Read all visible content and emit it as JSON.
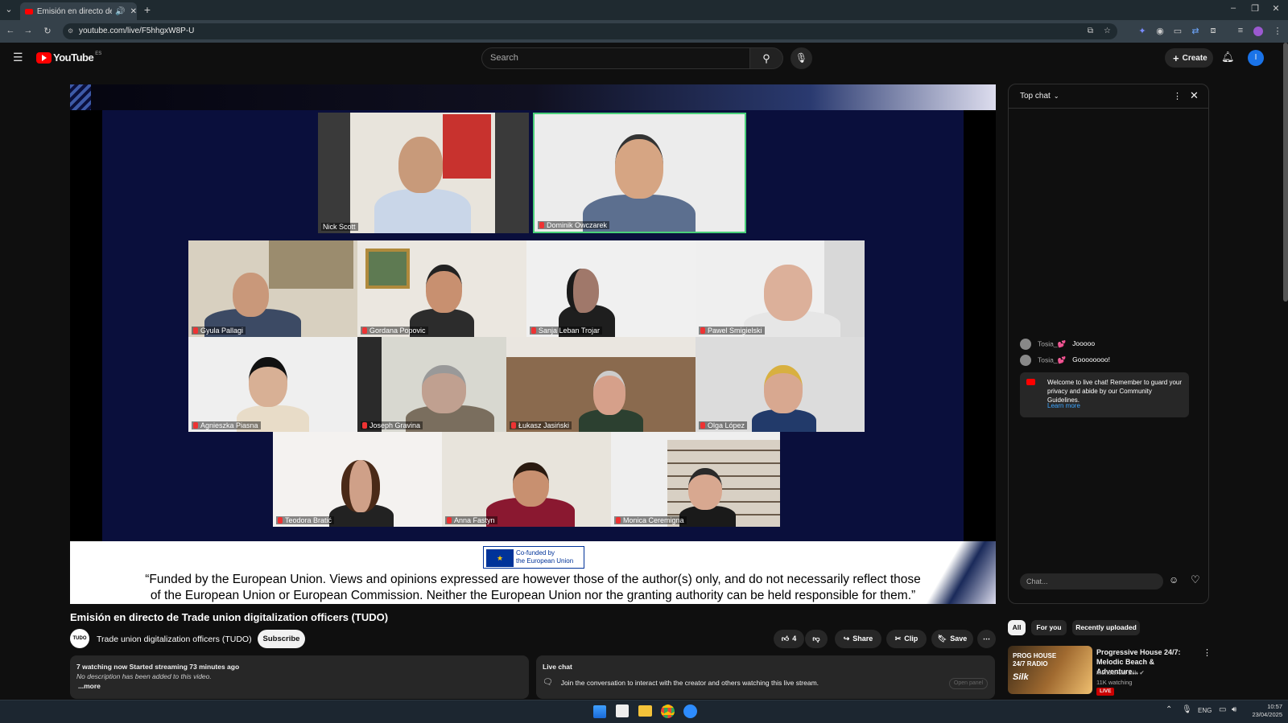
{
  "browser": {
    "tab_title": "Emisión en directo de Trad",
    "url": "youtube.com/live/F5hhgxW8P-U"
  },
  "header": {
    "logo_text": "YouTube",
    "logo_badge": "ES",
    "search_placeholder": "Search",
    "create_label": "Create",
    "avatar_letter": "I"
  },
  "video": {
    "participants": [
      {
        "name": "Nick Scott"
      },
      {
        "name": "Dominik Owczarek"
      },
      {
        "name": "Gyula Pallagi"
      },
      {
        "name": "Gordana Popovic"
      },
      {
        "name": "Sanja Leban Trojar"
      },
      {
        "name": "Pawel Smigielski"
      },
      {
        "name": "Agnieszka Piasna"
      },
      {
        "name": "Joseph Gravina"
      },
      {
        "name": "Łukasz Jasiński"
      },
      {
        "name": "Olga López"
      },
      {
        "name": "Teodora Bratić"
      },
      {
        "name": "Anna Fastyn"
      },
      {
        "name": "Monica Ceremigna"
      }
    ],
    "eu_line1": "Co-funded by",
    "eu_line2": "the European Union",
    "disclaimer_line1": "“Funded by the European Union. Views and opinions expressed are however those of the author(s) only, and do not necessarily reflect those",
    "disclaimer_line2": "of the European Union or European Commission. Neither the European Union nor the granting authority can be held responsible for them.”"
  },
  "chat": {
    "mode_label": "Top chat",
    "messages": [
      {
        "author": "Tosia_💕",
        "text": "Jooooo"
      },
      {
        "author": "Tosia_💕",
        "text": "Goooooooo!"
      }
    ],
    "welcome_text": "Welcome to live chat! Remember to guard your privacy and abide by our Community Guidelines.",
    "learn_more": "Learn more",
    "input_placeholder": "Chat..."
  },
  "meta": {
    "title": "Emisión en directo de Trade union digitalization officers (TUDO)",
    "channel_logo": "TUDO",
    "channel_name": "Trade union digitalization officers (TUDO)",
    "subscribe_label": "Subscribe",
    "like_count": "4",
    "share_label": "Share",
    "clip_label": "Clip",
    "save_label": "Save",
    "stats": "7 watching now  Started streaming 73 minutes ago",
    "description": "No description has been added to this video.",
    "more_label": "...more",
    "livechat_title": "Live chat",
    "livechat_text": "Join the conversation to interact with the creator and others watching this live stream.",
    "open_panel_label": "Open panel"
  },
  "recommendations": {
    "chips": [
      "All",
      "For you",
      "Recently uploaded"
    ],
    "items": [
      {
        "thumb_text": "PROG HOUSE 24/7 RADIO",
        "thumb_brand": "Silk",
        "title_line1": "Progressive House 24/7:",
        "title_line2": "Melodic Beach & Adventure...",
        "channel": "Monstercat Silk",
        "watching": "11K watching",
        "badge": "LIVE"
      }
    ]
  },
  "taskbar": {
    "lang": "ENG",
    "time": "10:57",
    "date": "23/04/2025"
  }
}
